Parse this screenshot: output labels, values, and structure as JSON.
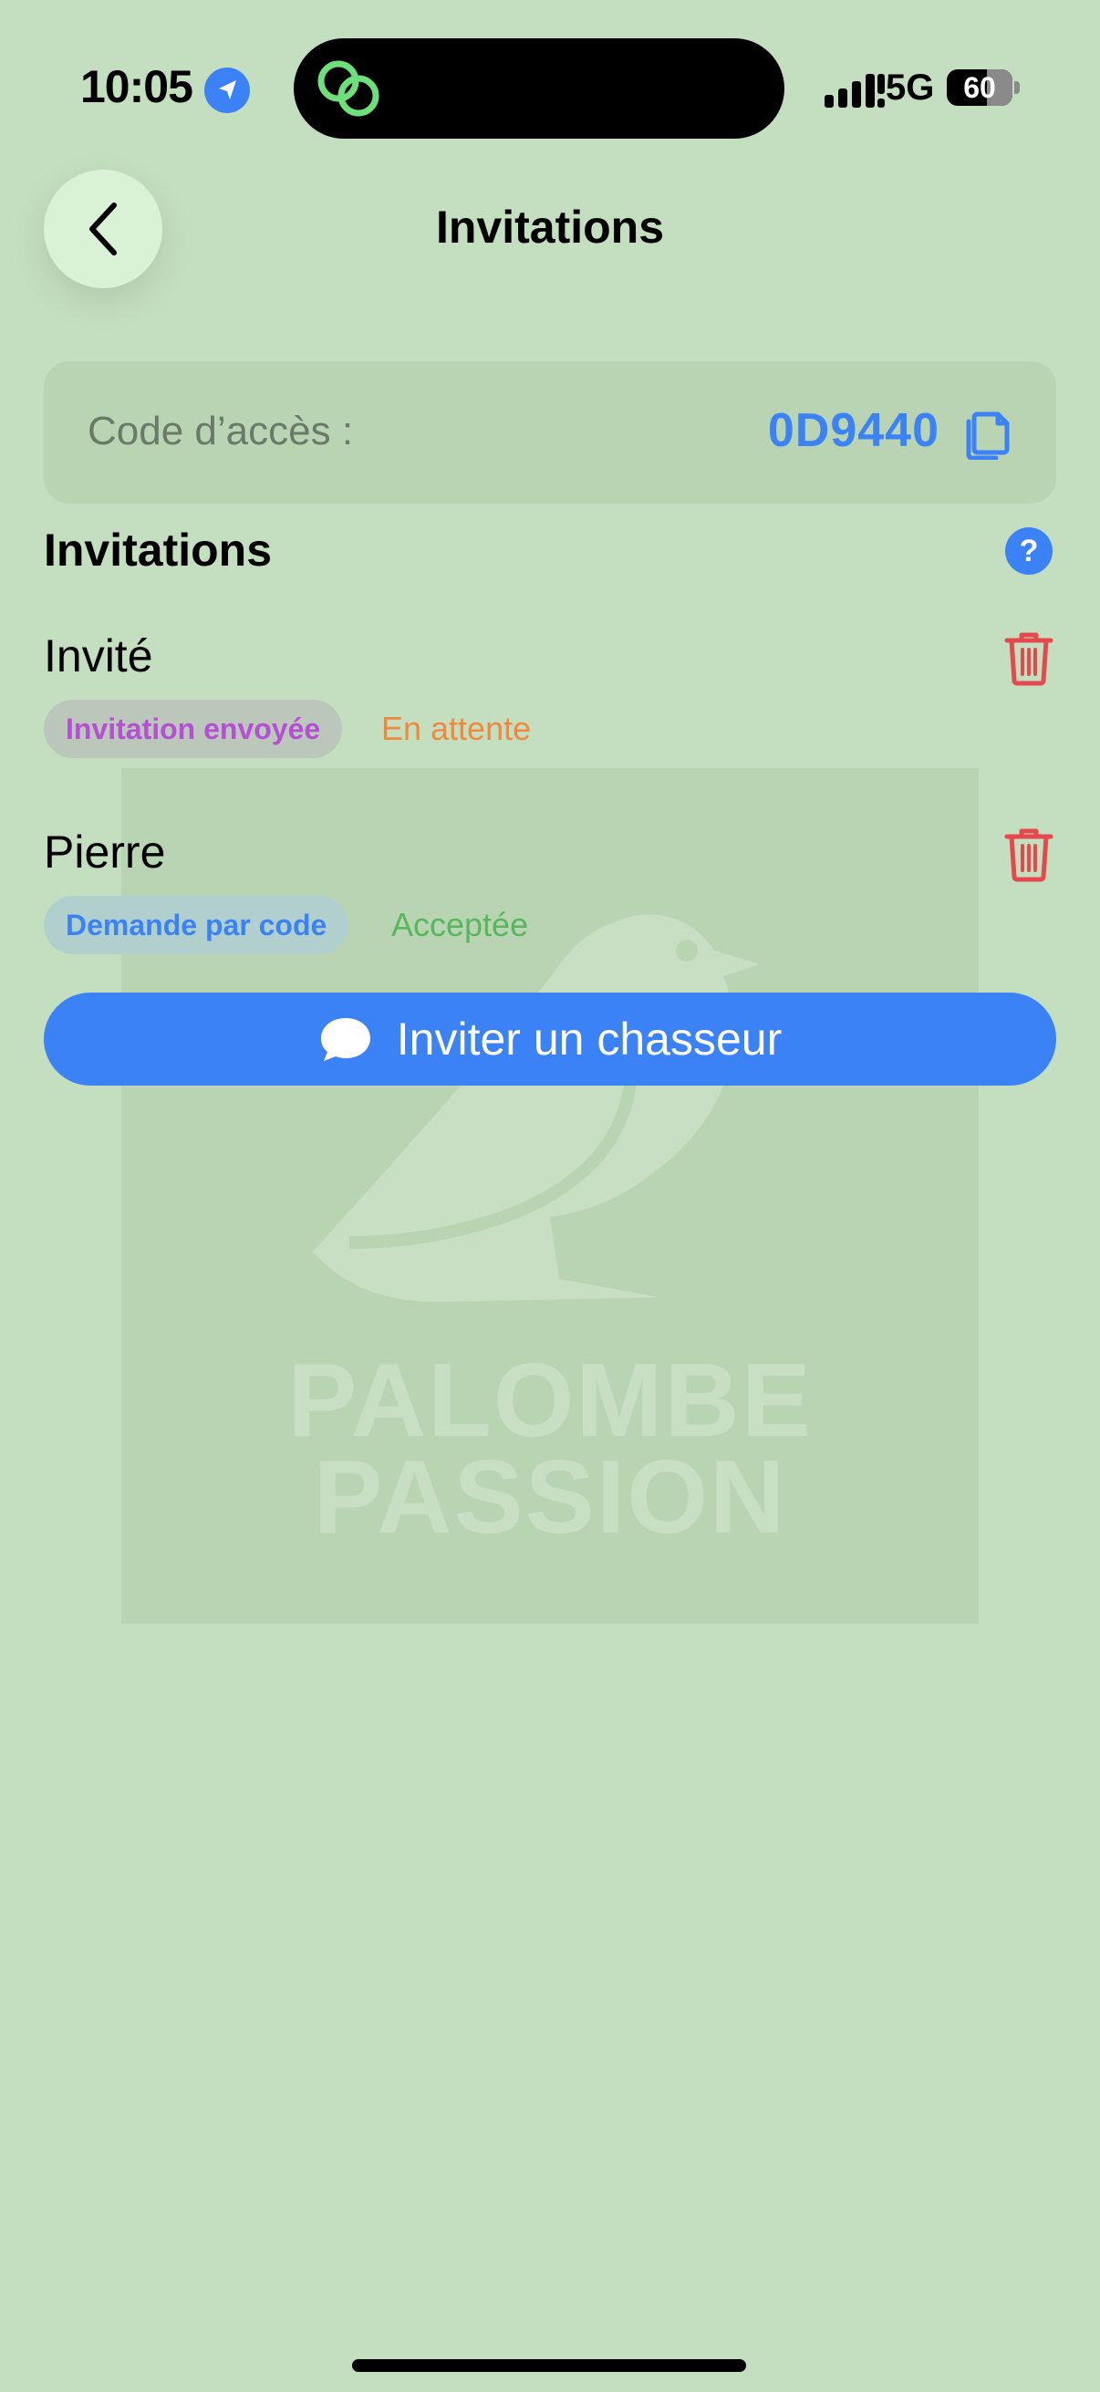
{
  "status_bar": {
    "time": "10:05",
    "network": "5G",
    "battery": "60"
  },
  "header": {
    "title": "Invitations",
    "back_icon": "chevron-left-icon"
  },
  "access_code": {
    "label": "Code d’accès :",
    "value": "0D9440",
    "copy_icon": "copy-icon"
  },
  "section": {
    "title": "Invitations",
    "help_label": "?"
  },
  "invitations": [
    {
      "name": "Invité",
      "badge": "Invitation envoyée",
      "status": "En attente",
      "status_color": "#f0883e"
    },
    {
      "name": "Pierre",
      "badge": "Demande par code",
      "status": "Acceptée",
      "status_color": "#58b75e"
    }
  ],
  "invite_button": {
    "label": "Inviter un chasseur",
    "icon": "chat-bubble-icon"
  },
  "watermark": {
    "line1": "PALOMBE",
    "line2": "PASSION"
  },
  "colors": {
    "background": "#c4dfbf",
    "accent": "#3b82f6",
    "danger": "#e5484d"
  }
}
